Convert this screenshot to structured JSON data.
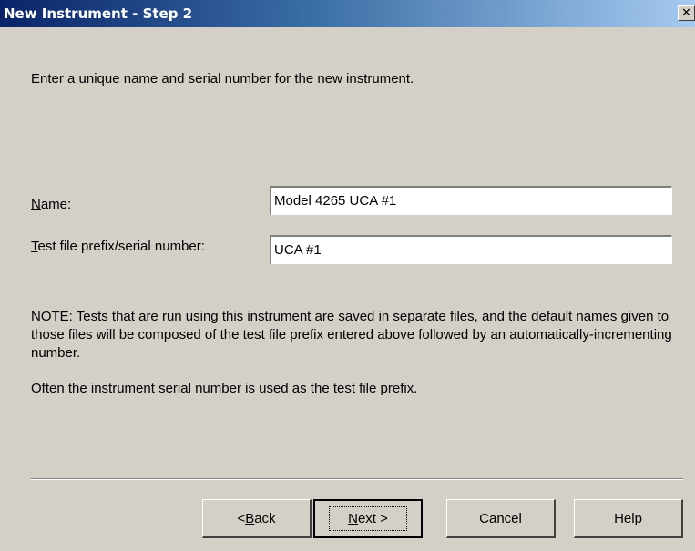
{
  "window": {
    "title": "New Instrument - Step 2",
    "close_glyph": "✕"
  },
  "intro_text": "Enter a unique name and serial number for the new instrument.",
  "form": {
    "name_label_mnemonic": "N",
    "name_label_rest": "ame:",
    "name_value": "Model 4265 UCA #1",
    "prefix_label_mnemonic": "T",
    "prefix_label_rest": "est file prefix/serial number:",
    "prefix_value": "UCA #1"
  },
  "note_text": "NOTE: Tests that are run using this instrument are saved in separate files, and the default names given to those files will be composed of the test file prefix entered above followed by an automatically-incrementing number.",
  "often_text": "Often the instrument serial number is used as the test file prefix.",
  "buttons": {
    "back_prefix": "< ",
    "back_mnemonic": "B",
    "back_rest": "ack",
    "next_mnemonic": "N",
    "next_rest": "ext >",
    "cancel": "Cancel",
    "help": "Help"
  }
}
